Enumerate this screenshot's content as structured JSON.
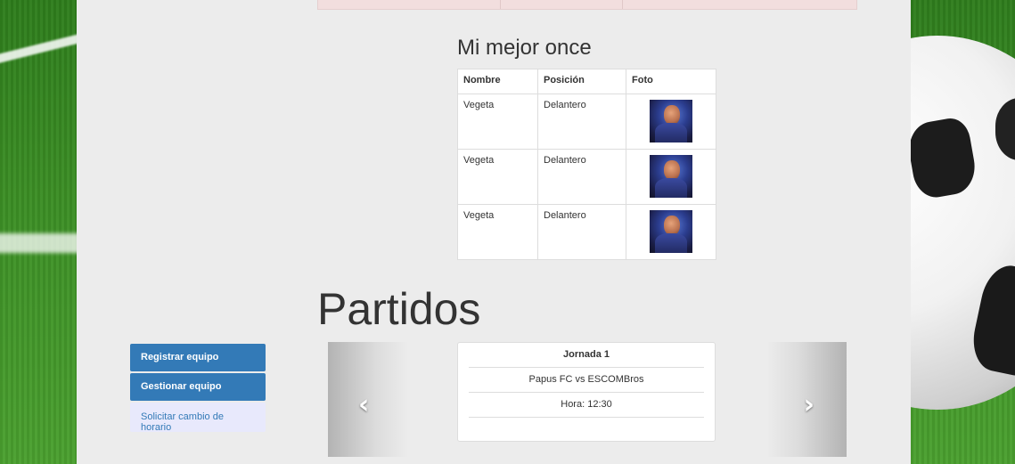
{
  "best_eleven": {
    "title": "Mi mejor once",
    "columns": [
      "Nombre",
      "Posición",
      "Foto"
    ],
    "rows": [
      {
        "nombre": "Vegeta",
        "posicion": "Delantero",
        "foto": "player-photo"
      },
      {
        "nombre": "Vegeta",
        "posicion": "Delantero",
        "foto": "player-photo"
      },
      {
        "nombre": "Vegeta",
        "posicion": "Delantero",
        "foto": "player-photo"
      }
    ]
  },
  "matches": {
    "title": "Partidos",
    "card": {
      "jornada": "Jornada 1",
      "teams": "Papus FC vs ESCOMBros",
      "hora": "Hora: 12:30"
    },
    "prev_icon": "chevron-left-icon",
    "next_icon": "chevron-right-icon"
  },
  "sidebar": {
    "items": [
      {
        "label": "Registrar equipo",
        "style": "primary"
      },
      {
        "label": "Gestionar equipo",
        "style": "primary"
      },
      {
        "label": "Solicitar cambio de horario",
        "style": "light"
      }
    ]
  },
  "colors": {
    "primary": "#337ab7",
    "light_button": "#e8e9fc",
    "container": "#ececec",
    "danger_row": "#f2dede"
  }
}
